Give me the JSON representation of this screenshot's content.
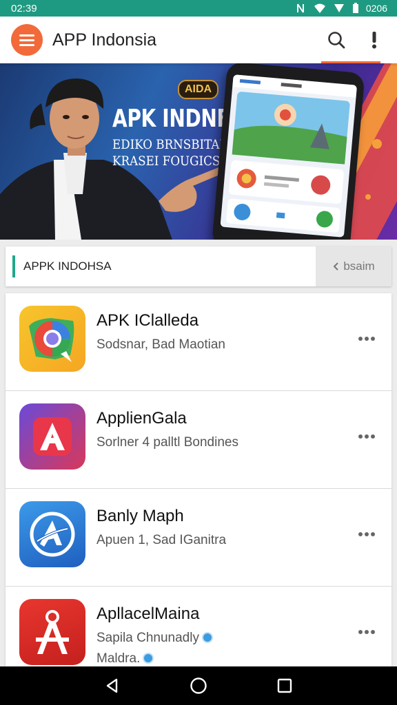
{
  "status_bar": {
    "time": "02:39",
    "battery": "0206"
  },
  "app_bar": {
    "title": "APP Indonsia"
  },
  "banner": {
    "badge": "AIDA",
    "heading": "APK INDNESIA",
    "subline1": "EDIKO BRNSBITAI",
    "subline2": "KRASEI FOUGICS"
  },
  "search": {
    "placeholder": "APPK INDOHSA",
    "action_label": "bsaim"
  },
  "apps": [
    {
      "name": "APK IClalleda",
      "desc": "Sodsnar, Bad Maotian",
      "desc2": "",
      "icon": "chrome-swirl-icon"
    },
    {
      "name": "ApplienGala",
      "desc": "Sorlner 4 palltl Bondines",
      "desc2": "",
      "icon": "letter-a-icon"
    },
    {
      "name": "Banly Maph",
      "desc": "Apuen 1, Sad IGanitra",
      "desc2": "",
      "icon": "app-store-icon"
    },
    {
      "name": "ApllacelMaina",
      "desc": "Sapila Chnunadly",
      "desc2": "Maldra.",
      "icon": "compass-a-icon"
    }
  ],
  "colors": {
    "status_bar": "#1f9a82",
    "accent": "#f26a3a",
    "search_accent": "#20a889"
  }
}
